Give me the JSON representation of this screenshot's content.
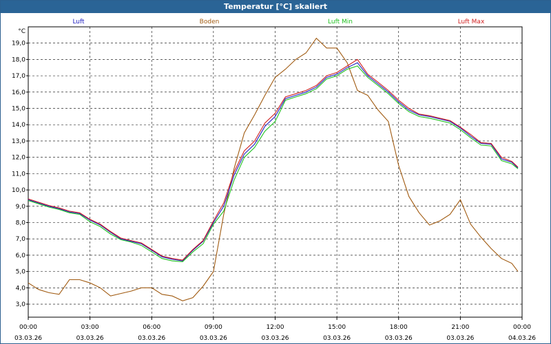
{
  "window": {
    "title": "Temperatur [°C] skaliert"
  },
  "chart_data": {
    "type": "line",
    "title": "Temperatur [°C] skaliert",
    "ylabel": "°C",
    "xlabel": "",
    "ylim": [
      2.2,
      20.0
    ],
    "xlim": [
      0,
      24
    ],
    "grid": true,
    "legend_placement": "top",
    "y_ticks": [
      "3,0",
      "4,0",
      "5,0",
      "6,0",
      "7,0",
      "8,0",
      "9,0",
      "10,0",
      "11,0",
      "12,0",
      "13,0",
      "14,0",
      "15,0",
      "16,0",
      "17,0",
      "18,0",
      "19,0"
    ],
    "x_ticks": [
      {
        "time": "00:00",
        "date": "03.03.26"
      },
      {
        "time": "03:00",
        "date": "03.03.26"
      },
      {
        "time": "06:00",
        "date": "03.03.26"
      },
      {
        "time": "09:00",
        "date": "03.03.26"
      },
      {
        "time": "12:00",
        "date": "03.03.26"
      },
      {
        "time": "15:00",
        "date": "03.03.26"
      },
      {
        "time": "18:00",
        "date": "03.03.26"
      },
      {
        "time": "21:00",
        "date": "03.03.26"
      },
      {
        "time": "00:00",
        "date": "04.03.26"
      }
    ],
    "series": [
      {
        "name": "Luft",
        "color": "#2020c0",
        "x": [
          0,
          0.5,
          1,
          1.5,
          2,
          2.5,
          3,
          3.5,
          4,
          4.5,
          5,
          5.5,
          6,
          6.5,
          7,
          7.5,
          8,
          8.5,
          9,
          9.5,
          10,
          10.5,
          11,
          11.5,
          12,
          12.5,
          13,
          13.5,
          14,
          14.5,
          15,
          15.5,
          16,
          16.5,
          17,
          17.5,
          18,
          18.5,
          19,
          19.5,
          20,
          20.5,
          21,
          21.5,
          22,
          22.5,
          23,
          23.5,
          23.8
        ],
        "values": [
          9.4,
          9.2,
          9.0,
          8.85,
          8.65,
          8.55,
          8.15,
          7.85,
          7.4,
          7.0,
          6.85,
          6.7,
          6.3,
          5.9,
          5.75,
          5.65,
          6.3,
          6.85,
          8.0,
          9.0,
          10.9,
          12.2,
          12.8,
          13.9,
          14.5,
          15.6,
          15.8,
          16.0,
          16.3,
          16.9,
          17.1,
          17.5,
          17.8,
          17.0,
          16.5,
          16.0,
          15.4,
          14.9,
          14.6,
          14.5,
          14.35,
          14.2,
          13.8,
          13.3,
          12.85,
          12.8,
          11.9,
          11.7,
          11.35
        ]
      },
      {
        "name": "Boden",
        "color": "#a05a10",
        "x": [
          0,
          0.5,
          1,
          1.5,
          2,
          2.5,
          3,
          3.5,
          4,
          4.5,
          5,
          5.5,
          6,
          6.5,
          7,
          7.5,
          8,
          8.5,
          9,
          9.5,
          10,
          10.5,
          11,
          11.5,
          12,
          12.5,
          13,
          13.5,
          14,
          14.5,
          15,
          15.5,
          16,
          16.5,
          17,
          17.5,
          18,
          18.5,
          19,
          19.5,
          20,
          20.5,
          21,
          21.5,
          22,
          22.5,
          23,
          23.5,
          23.8
        ],
        "values": [
          4.3,
          3.9,
          3.7,
          3.6,
          4.5,
          4.5,
          4.3,
          4.0,
          3.5,
          3.65,
          3.8,
          4.0,
          4.0,
          3.6,
          3.5,
          3.2,
          3.4,
          4.1,
          5.0,
          8.5,
          11.3,
          13.5,
          14.6,
          15.8,
          16.9,
          17.4,
          18.0,
          18.4,
          19.3,
          18.7,
          18.7,
          17.8,
          16.1,
          15.8,
          14.9,
          14.2,
          11.5,
          9.6,
          8.6,
          7.85,
          8.1,
          8.5,
          9.4,
          7.9,
          7.1,
          6.4,
          5.8,
          5.5,
          5.0
        ]
      },
      {
        "name": "Luft Min",
        "color": "#20c020",
        "x": [
          0,
          0.5,
          1,
          1.5,
          2,
          2.5,
          3,
          3.5,
          4,
          4.5,
          5,
          5.5,
          6,
          6.5,
          7,
          7.5,
          8,
          8.5,
          9,
          9.5,
          10,
          10.5,
          11,
          11.5,
          12,
          12.5,
          13,
          13.5,
          14,
          14.5,
          15,
          15.5,
          16,
          16.5,
          17,
          17.5,
          18,
          18.5,
          19,
          19.5,
          20,
          20.5,
          21,
          21.5,
          22,
          22.5,
          23,
          23.5,
          23.8
        ],
        "values": [
          9.35,
          9.15,
          8.95,
          8.8,
          8.6,
          8.5,
          8.05,
          7.75,
          7.3,
          6.95,
          6.8,
          6.6,
          6.2,
          5.8,
          5.65,
          5.6,
          6.2,
          6.7,
          7.9,
          8.7,
          10.6,
          12.0,
          12.6,
          13.6,
          14.2,
          15.5,
          15.7,
          15.9,
          16.2,
          16.8,
          17.0,
          17.4,
          17.6,
          16.9,
          16.4,
          15.9,
          15.3,
          14.8,
          14.5,
          14.4,
          14.25,
          14.1,
          13.7,
          13.2,
          12.75,
          12.7,
          11.8,
          11.6,
          11.3
        ]
      },
      {
        "name": "Luft Max",
        "color": "#d02020",
        "x": [
          0,
          0.5,
          1,
          1.5,
          2,
          2.5,
          3,
          3.5,
          4,
          4.5,
          5,
          5.5,
          6,
          6.5,
          7,
          7.5,
          8,
          8.5,
          9,
          9.5,
          10,
          10.5,
          11,
          11.5,
          12,
          12.5,
          13,
          13.5,
          14,
          14.5,
          15,
          15.5,
          16,
          16.5,
          17,
          17.5,
          18,
          18.5,
          19,
          19.5,
          20,
          20.5,
          21,
          21.5,
          22,
          22.5,
          23,
          23.5,
          23.8
        ],
        "values": [
          9.45,
          9.25,
          9.05,
          8.9,
          8.7,
          8.6,
          8.2,
          7.9,
          7.45,
          7.05,
          6.9,
          6.75,
          6.35,
          5.95,
          5.8,
          5.7,
          6.35,
          6.9,
          8.1,
          9.2,
          11.1,
          12.4,
          13.0,
          14.1,
          14.7,
          15.7,
          15.9,
          16.1,
          16.4,
          17.0,
          17.2,
          17.6,
          18.0,
          17.1,
          16.6,
          16.1,
          15.5,
          15.0,
          14.65,
          14.55,
          14.4,
          14.25,
          13.85,
          13.4,
          12.9,
          12.85,
          12.0,
          11.75,
          11.4
        ]
      }
    ]
  }
}
